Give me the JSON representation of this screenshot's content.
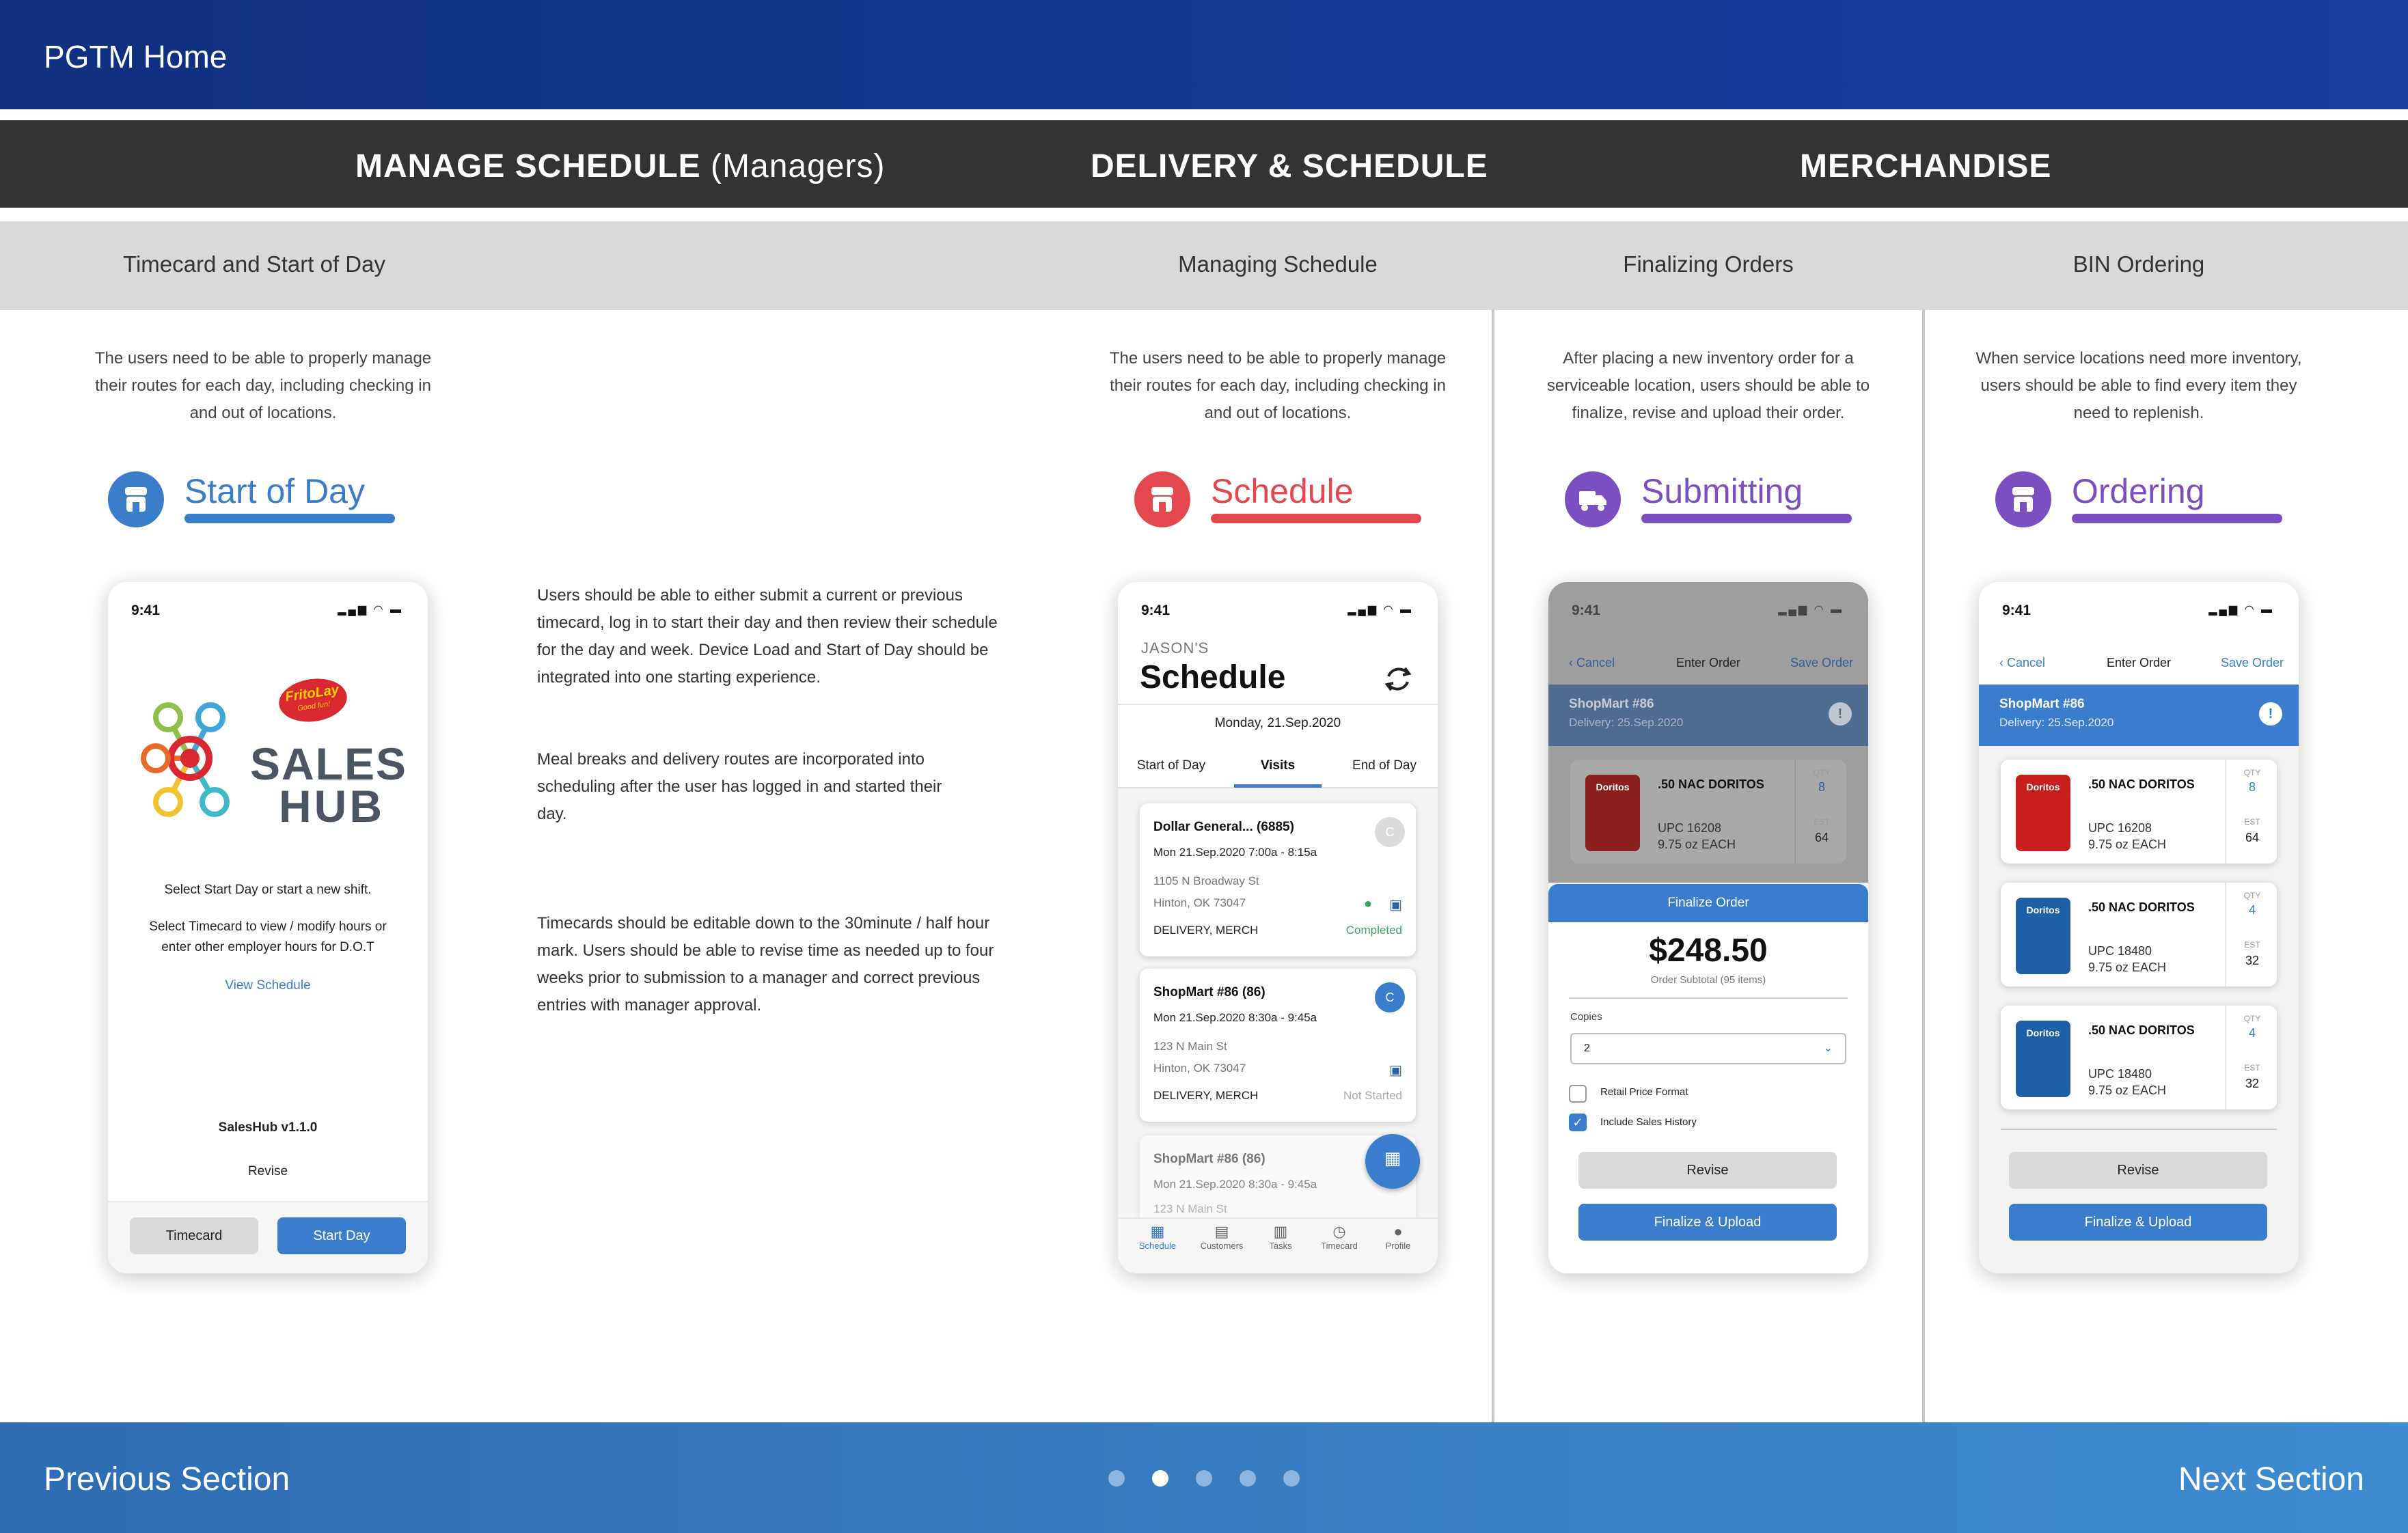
{
  "top": {
    "title": "PGTM Home"
  },
  "sections": {
    "manage": "MANAGE SCHEDULE",
    "manage_sub": "(Managers)",
    "delivery": "DELIVERY & SCHEDULE",
    "merch": "MERCHANDISE"
  },
  "subsections": [
    "Timecard and Start of Day",
    "Managing Schedule",
    "Finalizing Orders",
    "BIN Ordering"
  ],
  "descriptions": [
    "The users need to be able to properly manage their routes for each day, including checking in and out of locations.",
    "The users need to be able to properly manage their routes for each day, including checking in and out of locations.",
    "After placing a new inventory order for a serviceable location, users should be able to finalize, revise and upload their order.",
    "When service locations need more inventory, users should be able to find every item they need to replenish."
  ],
  "headers": [
    {
      "label": "Start of Day",
      "color": "#3a7dc9"
    },
    {
      "label": "Schedule",
      "color": "#e5474f"
    },
    {
      "label": "Submitting",
      "color": "#7b4fc0"
    },
    {
      "label": "Ordering",
      "color": "#7b4fc0"
    }
  ],
  "body_text": {
    "p1": "Users should be able to either submit a current or previous timecard, log in to start their day and then review their schedule for the day and week. Device Load and Start of Day should be integrated into one starting experience.",
    "p2": "Meal breaks and delivery routes are incorporated into scheduling after the user has logged in and started their day.",
    "p3": "Timecards should be editable down to the 30minute / half hour mark. Users should be able to revise time as needed up to four weeks prior to submission to a manager and correct previous entries with manager approval."
  },
  "status": {
    "time": "9:41",
    "icons": "signal-icon wifi-icon battery-icon"
  },
  "phone1": {
    "brand_sales": "SALES",
    "brand_hub": "HUB",
    "logo_text": "FritoLay",
    "logo_tagline": "Good fun!",
    "line1": "Select Start Day or start a new shift.",
    "line2": "Select Timecard to view / modify hours or enter other employer hours for D.O.T",
    "link": "View Schedule",
    "version": "SalesHub v1.1.0",
    "revise": "Revise",
    "btn_timecard": "Timecard",
    "btn_start": "Start Day"
  },
  "phone2": {
    "owner": "JASON'S",
    "title": "Schedule",
    "date": "Monday, 21.Sep.2020",
    "tabs": [
      "Start of Day",
      "Visits",
      "End of Day"
    ],
    "visits": [
      {
        "name": "Dollar General... (6885)",
        "when": "Mon 21.Sep.2020  7:00a - 8:15a",
        "addr1": "1105 N Broadway St",
        "addr2": "Hinton, OK 73047",
        "type": "DELIVERY, MERCH",
        "status": "Completed",
        "badge": "C"
      },
      {
        "name": "ShopMart #86 (86)",
        "when": "Mon 21.Sep.2020  8:30a - 9:45a",
        "addr1": "123 N Main St",
        "addr2": "Hinton, OK 73047",
        "type": "DELIVERY, MERCH",
        "status": "Not Started",
        "badge": "C"
      },
      {
        "name": "ShopMart #86 (86)",
        "when": "Mon 21.Sep.2020  8:30a - 9:45a",
        "addr1": "123 N Main St"
      }
    ],
    "tabbar": [
      "Schedule",
      "Customers",
      "Tasks",
      "Timecard",
      "Profile"
    ]
  },
  "phone3": {
    "cancel": "Cancel",
    "nav_title": "Enter Order",
    "save": "Save Order",
    "store": "ShopMart #86",
    "delivery": "Delivery: 25.Sep.2020",
    "product": ".50 NAC DORITOS",
    "upc": "UPC 16208",
    "each": "9.75 oz EACH",
    "qty_label": "QTY",
    "qty": "8",
    "est_label": "EST",
    "est": "64",
    "finalize_title": "Finalize Order",
    "total": "$248.50",
    "subtotal": "Order Subtotal (95 items)",
    "copies_label": "Copies",
    "copies_value": "2",
    "opt1": "Retail Price Format",
    "opt2": "Include Sales History",
    "revise": "Revise",
    "finalize": "Finalize & Upload"
  },
  "phone4": {
    "cancel": "Cancel",
    "nav_title": "Enter Order",
    "save": "Save Order",
    "store": "ShopMart #86",
    "delivery": "Delivery: 25.Sep.2020",
    "products": [
      {
        "name": ".50 NAC DORITOS",
        "upc": "UPC 16208",
        "each": "9.75 oz EACH",
        "qty": "8",
        "est": "64",
        "color": "#c81e1e"
      },
      {
        "name": ".50 NAC DORITOS",
        "upc": "UPC 18480",
        "each": "9.75 oz EACH",
        "qty": "4",
        "est": "32",
        "color": "#1f5fa8"
      },
      {
        "name": ".50 NAC DORITOS",
        "upc": "UPC 18480",
        "each": "9.75 oz EACH",
        "qty": "4",
        "est": "32",
        "color": "#1f5fa8"
      }
    ],
    "qty_label": "QTY",
    "est_label": "EST",
    "chip_brand": "Doritos",
    "revise": "Revise",
    "finalize": "Finalize & Upload"
  },
  "bottom": {
    "prev": "Previous Section",
    "next": "Next Section",
    "pages": 5,
    "active_page": 2
  }
}
